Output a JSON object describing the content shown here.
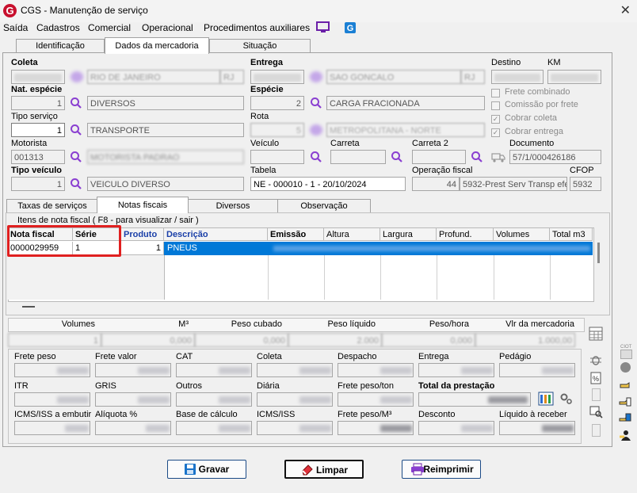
{
  "window": {
    "title": "CGS - Manutenção de serviço",
    "logo": "G"
  },
  "menu": [
    "Saída",
    "Cadastros",
    "Comercial",
    "Operacional",
    "Procedimentos auxiliares"
  ],
  "tabs": [
    "Identificação",
    "Dados da mercadoria",
    "Situação"
  ],
  "route": {
    "coleta": "Coleta",
    "entrega": "Entrega",
    "destino": "Destino",
    "km": "KM",
    "coleta_city": "RIO DE JANEIRO",
    "coleta_uf": "RJ",
    "entrega_city": "SAO GONCALO",
    "entrega_uf": "RJ"
  },
  "nat_especie": {
    "label": "Nat. espécie",
    "code": "1",
    "desc": "DIVERSOS"
  },
  "especie": {
    "label": "Espécie",
    "code": "2",
    "desc": "CARGA FRACIONADA"
  },
  "tipo_servico": {
    "label": "Tipo serviço",
    "code": "1",
    "desc": "TRANSPORTE"
  },
  "rota": {
    "label": "Rota",
    "code": "5",
    "desc": "METROPOLITANA - NORTE"
  },
  "motorista": {
    "label": "Motorista",
    "code": "001313",
    "name": "MOTORISTA PADRAO"
  },
  "veiculo": {
    "label": "Veículo"
  },
  "carreta": {
    "label": "Carreta"
  },
  "carreta2": {
    "label": "Carreta 2"
  },
  "documento": {
    "label": "Documento",
    "value": "57/1/000426186"
  },
  "tipo_veiculo": {
    "label": "Tipo veículo",
    "code": "1",
    "desc": "VEICULO DIVERSO"
  },
  "tabela": {
    "label": "Tabela",
    "value": "NE - 000010 - 1 - 20/10/2024"
  },
  "operacao": {
    "label": "Operação fiscal",
    "code": "44",
    "desc": "5932-Prest Serv Transp efe"
  },
  "cfop": {
    "label": "CFOP",
    "value": "5932"
  },
  "checks": [
    "Frete combinado",
    "Comissão por frete",
    "Cobrar coleta",
    "Cobrar entrega"
  ],
  "subtabs": [
    "Taxas de serviços",
    "Notas fiscais",
    "Diversos",
    "Observação"
  ],
  "nf_group": "Itens de nota fiscal ( F8 - para visualizar / sair )",
  "grid_headers": [
    "Nota fiscal",
    "Série",
    "Produto",
    "Descrição",
    "Emissão",
    "Altura",
    "Largura",
    "Profund.",
    "Volumes",
    "Total m3"
  ],
  "grid_row": {
    "nota": "0000029959",
    "serie": "1",
    "produto": "1",
    "descricao": "PNEUS"
  },
  "totals_headers": [
    "Volumes",
    "M³",
    "Peso cubado",
    "Peso líquido",
    "Peso/hora",
    "Vlr da mercadoria"
  ],
  "totals_values": [
    "1",
    "0,000",
    "0,000",
    "2.000",
    "0,000",
    "1.000,00"
  ],
  "frete_row1": [
    "Frete peso",
    "Frete valor",
    "CAT",
    "Coleta",
    "Despacho",
    "Entrega",
    "Pedágio"
  ],
  "frete_row2": [
    "ITR",
    "GRIS",
    "Outros",
    "Diária",
    "Frete peso/ton",
    "Total da prestação"
  ],
  "frete_row3": [
    "ICMS/ISS a embutir",
    "Alíquota %",
    "Base de cálculo",
    "ICMS/ISS",
    "Frete peso/M³",
    "Desconto",
    "Líquido à receber"
  ],
  "buttons": {
    "gravar": "Gravar",
    "limpar": "Limpar",
    "reimprimir": "Reimprimir"
  },
  "side_label": "CIOT",
  "colors": {
    "accent": "#0078d7",
    "highlight_border": "#e02020",
    "brand": "#c8102e"
  }
}
